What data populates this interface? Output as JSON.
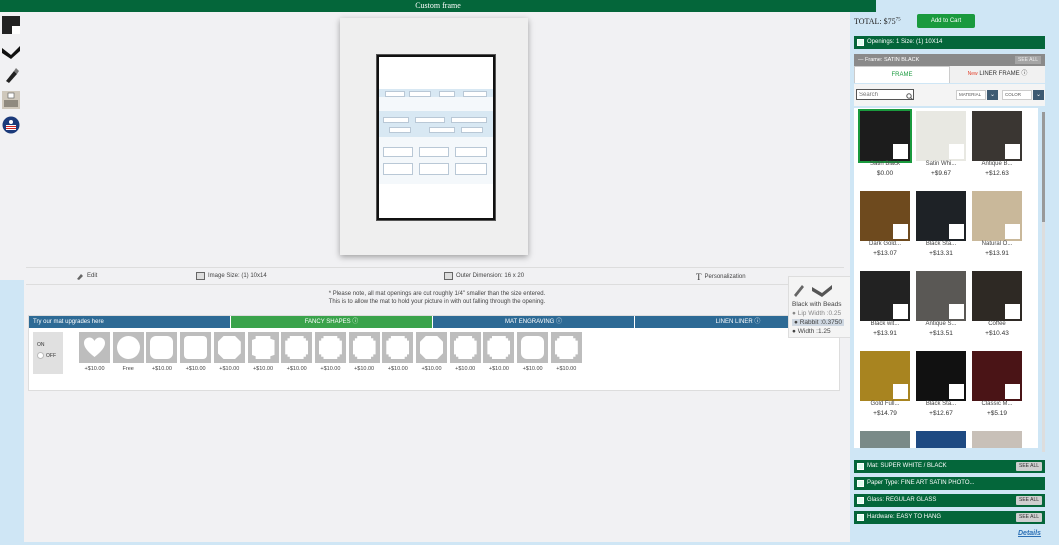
{
  "header": {
    "title": "Custom frame"
  },
  "left_icons": [
    {
      "name": "frame-swatch-icon"
    },
    {
      "name": "frame-profile-icon"
    },
    {
      "name": "pencil-brush-icon"
    },
    {
      "name": "room-view-icon"
    },
    {
      "name": "flag-seal-icon"
    }
  ],
  "info_bar": {
    "edit": "Edit",
    "image_size": "Image Size: (1) 10x14",
    "outer_dimension": "Outer Dimension: 16 x 20",
    "personalization": "Personalization"
  },
  "note": {
    "line1": "* Please note, all mat openings are cut roughly 1/4\" smaller than the size entered.",
    "line2": "This is to allow the mat to hold your picture in with out falling through the opening."
  },
  "upgrades": {
    "tabs": [
      "Try our mat upgrades here",
      "FANCY SHAPES ⓘ",
      "MAT ENGRAVING ⓘ",
      "LINEN LINER ⓘ"
    ],
    "toggle_on": "ON",
    "toggle_off": "OFF",
    "shapes": [
      {
        "shape": "heart",
        "price": "+$10.00"
      },
      {
        "shape": "circle",
        "price": "Free"
      },
      {
        "shape": "scalloped",
        "price": "+$10.00"
      },
      {
        "shape": "rounded",
        "price": "+$10.00"
      },
      {
        "shape": "octagon",
        "price": "+$10.00"
      },
      {
        "shape": "notched",
        "price": "+$10.00"
      },
      {
        "shape": "ornate",
        "price": "+$10.00"
      },
      {
        "shape": "ornate",
        "price": "+$10.00"
      },
      {
        "shape": "ornate",
        "price": "+$10.00"
      },
      {
        "shape": "ornate",
        "price": "+$10.00"
      },
      {
        "shape": "octagon",
        "price": "+$10.00"
      },
      {
        "shape": "ornate",
        "price": "+$10.00"
      },
      {
        "shape": "ornate",
        "price": "+$10.00"
      },
      {
        "shape": "scalloped",
        "price": "+$10.00"
      },
      {
        "shape": "ornate",
        "price": "+$10.00"
      }
    ]
  },
  "tooltip": {
    "title": "Black with Beads",
    "lip_width": "Lip Width :0.25",
    "rabbit": "Rabbit :0.3750",
    "width": "Width :1.25"
  },
  "right_panel": {
    "total_label": "TOTAL:",
    "total_dollars": "$75",
    "total_cents": "75",
    "add_to_cart": "Add to Cart",
    "openings": "Openings:   1   Size: (1) 10X14",
    "frame_header": "— Frame: SATIN BLACK",
    "see_all": "SEE ALL",
    "tab_frame": "FRAME",
    "tab_new": "New",
    "tab_liner": "LINER FRAME ⓘ",
    "search_placeholder": "Search",
    "filter_material": "MATERIAL",
    "filter_color": "COLOR",
    "frames": [
      {
        "name": "Satin Black",
        "price": "$0.00",
        "color": "#1c1c1c",
        "selected": true
      },
      {
        "name": "Satin Whi...",
        "price": "+$9.67",
        "color": "#e8e8e2"
      },
      {
        "name": "Antique B...",
        "price": "+$12.63",
        "color": "#3a3632"
      },
      {
        "name": "Dark Gold...",
        "price": "+$13.07",
        "color": "#6e4a1e"
      },
      {
        "name": "Black Sta...",
        "price": "+$13.31",
        "color": "#1e2226"
      },
      {
        "name": "Natural O...",
        "price": "+$13.91",
        "color": "#c9b89a"
      },
      {
        "name": "Black wit...",
        "price": "+$13.91",
        "color": "#222"
      },
      {
        "name": "Antique S...",
        "price": "+$13.51",
        "color": "#5a5855"
      },
      {
        "name": "Coffee",
        "price": "+$10.43",
        "color": "#2e2924"
      },
      {
        "name": "Gold Full...",
        "price": "+$14.79",
        "color": "#a88420"
      },
      {
        "name": "Black Sta...",
        "price": "+$12.67",
        "color": "#111"
      },
      {
        "name": "Classic M...",
        "price": "+$5.19",
        "color": "#4a1416"
      },
      {
        "name": "",
        "price": "",
        "color": "#7a8a88"
      },
      {
        "name": "",
        "price": "",
        "color": "#1e4a82"
      },
      {
        "name": "",
        "price": "",
        "color": "#c8c0b8"
      }
    ],
    "bars": [
      {
        "label": "Mat: SUPER WHITE / BLACK",
        "action": "SEE ALL"
      },
      {
        "label": "Paper Type: FINE ART SATIN PHOTO...",
        "action": ""
      },
      {
        "label": "Glass: REGULAR GLASS",
        "action": "SEE ALL"
      },
      {
        "label": "Hardware: EASY TO HANG",
        "action": "SEE ALL"
      }
    ],
    "details": "Details"
  }
}
